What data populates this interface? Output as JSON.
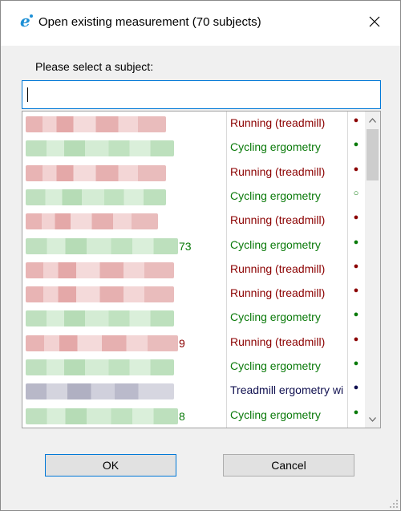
{
  "window": {
    "title": "Open existing measurement (70 subjects)",
    "close_label": "✕"
  },
  "search": {
    "prompt": "Please select a subject:",
    "value": "",
    "placeholder": ""
  },
  "colors": {
    "running": "#8b0000",
    "cycling": "#0a7a0a",
    "treadmill": "#101050",
    "accent": "#0078d7"
  },
  "subjects": [
    {
      "name_tail": "",
      "type": "Running (treadmill)",
      "status": "●",
      "kind": "running"
    },
    {
      "name_tail": "",
      "type": "Cycling ergometry",
      "status": "●",
      "kind": "cycling"
    },
    {
      "name_tail": "",
      "type": "Running (treadmill)",
      "status": "●",
      "kind": "running"
    },
    {
      "name_tail": "",
      "type": "Cycling ergometry",
      "status": "○",
      "kind": "cycling"
    },
    {
      "name_tail": "",
      "type": "Running (treadmill)",
      "status": "●",
      "kind": "running"
    },
    {
      "name_tail": "73",
      "type": "Cycling ergometry",
      "status": "●",
      "kind": "cycling"
    },
    {
      "name_tail": "",
      "type": "Running (treadmill)",
      "status": "●",
      "kind": "running"
    },
    {
      "name_tail": "",
      "type": "Running (treadmill)",
      "status": "●",
      "kind": "running"
    },
    {
      "name_tail": "",
      "type": "Cycling ergometry",
      "status": "●",
      "kind": "cycling"
    },
    {
      "name_tail": "9",
      "type": "Running (treadmill)",
      "status": "●",
      "kind": "running"
    },
    {
      "name_tail": "",
      "type": "Cycling ergometry",
      "status": "●",
      "kind": "cycling"
    },
    {
      "name_tail": "",
      "type": "Treadmill ergometry wi",
      "status": "●",
      "kind": "treadmill"
    },
    {
      "name_tail": "8",
      "type": "Cycling ergometry",
      "status": "●",
      "kind": "cycling"
    }
  ],
  "buttons": {
    "ok": "OK",
    "cancel": "Cancel"
  },
  "icons": {
    "app": "app-logo-icon",
    "close": "close-icon",
    "scroll_up": "chevron-up-icon",
    "scroll_down": "chevron-down-icon",
    "grip": "resize-grip-icon"
  }
}
